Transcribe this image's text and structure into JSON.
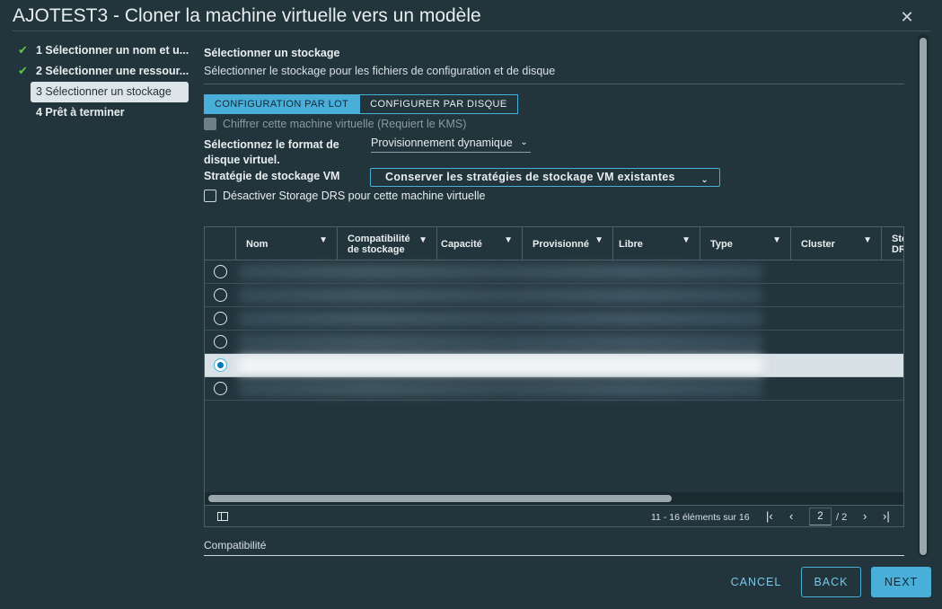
{
  "window": {
    "title": "AJOTEST3 - Cloner la machine virtuelle vers un modèle",
    "close_glyph": "✕"
  },
  "steps": [
    {
      "label": "1 Sélectionner un nom et u...",
      "state": "done"
    },
    {
      "label": "2 Sélectionner une ressour...",
      "state": "done"
    },
    {
      "label": "3 Sélectionner un stockage",
      "state": "active"
    },
    {
      "label": "4 Prêt à terminer",
      "state": "pending"
    }
  ],
  "section": {
    "title": "Sélectionner un stockage",
    "description": "Sélectionner le stockage pour les fichiers de configuration et de disque"
  },
  "toggle": {
    "batch_label": "CONFIGURATION PAR LOT",
    "per_disk_label": "CONFIGURER PAR DISQUE",
    "selected": "batch"
  },
  "encrypt": {
    "label": "Chiffrer cette machine virtuelle (Requiert le KMS)",
    "checked": false,
    "disabled": true
  },
  "disk_format": {
    "label": "Sélectionnez le format de disque virtuel.",
    "value": "Provisionnement dynamique"
  },
  "vm_policy": {
    "label": "Stratégie de stockage VM",
    "value": "Conserver les stratégies de stockage VM existantes"
  },
  "drs": {
    "label": "Désactiver Storage DRS pour cette machine virtuelle",
    "checked": false
  },
  "grid": {
    "columns": [
      "Nom",
      "Compatibilité de stockage",
      "Capacité",
      "Provisionné",
      "Libre",
      "Type",
      "Cluster",
      "Storage DRS"
    ],
    "column_truncated": [
      "Nom",
      "Compatibilité de stockage",
      "Capacité",
      "Provisionné",
      "Libre",
      "Type",
      "Cluster",
      "Sto DRS"
    ],
    "rows": [
      {
        "selected": false
      },
      {
        "selected": false
      },
      {
        "selected": false
      },
      {
        "selected": false
      },
      {
        "selected": true
      },
      {
        "selected": false
      }
    ],
    "footer": {
      "range": "11 - 16 éléments sur 16",
      "page_current": "2",
      "page_total": "/ 2"
    }
  },
  "compat_label": "Compatibilité",
  "actions": {
    "cancel": "CANCEL",
    "back": "BACK",
    "next": "NEXT"
  },
  "colors": {
    "accent": "#49afd9",
    "background": "#22343c",
    "check": "#5fc34c"
  },
  "icons": [
    "close-icon",
    "check-icon",
    "chevron-down-icon",
    "filter-icon",
    "first-page-icon",
    "prev-page-icon",
    "next-page-icon",
    "last-page-icon",
    "column-toggle-icon"
  ]
}
